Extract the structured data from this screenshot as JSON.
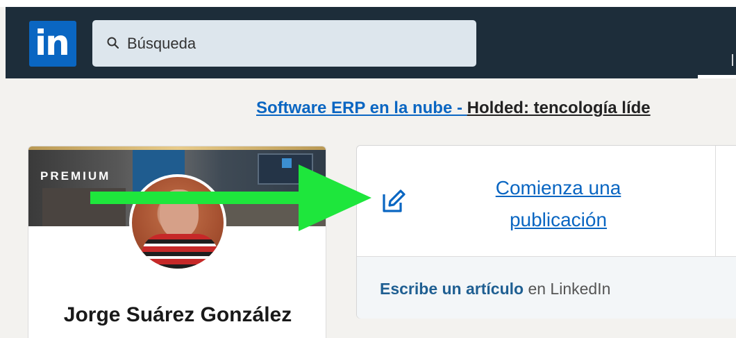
{
  "navbar": {
    "logo_text": "in",
    "search": {
      "placeholder": "Búsqueda"
    }
  },
  "ad": {
    "link_text": "Software ERP en la nube - ",
    "text": "Holded: tencología líde"
  },
  "profile": {
    "badge": "PREMIUM",
    "name": "Jorge Suárez González"
  },
  "post_box": {
    "start_post_label": "Comienza una publicación",
    "article_strong": "Escribe un artículo",
    "article_rest": " en LinkedIn"
  },
  "colors": {
    "navbar": "#1d2d3a",
    "brand_blue": "#0a66c2",
    "arrow_green": "#1ee63c"
  }
}
